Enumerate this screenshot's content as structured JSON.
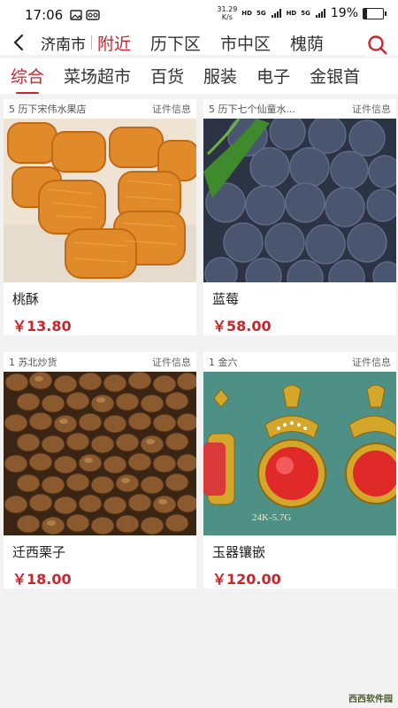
{
  "status": {
    "time": "17:06",
    "speed_value": "31.29",
    "speed_unit": "K/s",
    "hd1": "HD",
    "net1": "5G",
    "hd2": "HD",
    "net2": "5G",
    "battery": "19%",
    "battery_level": 0.19
  },
  "nav": {
    "city": "济南市",
    "tabs": [
      "附近",
      "历下区",
      "市中区",
      "槐荫"
    ]
  },
  "categories": [
    "综合",
    "菜场超市",
    "百货",
    "服装",
    "电子",
    "金银首"
  ],
  "products": [
    {
      "shop": "5 历下宋伟水果店",
      "cert": "证件信息",
      "name": "桃酥",
      "price": "￥13.80"
    },
    {
      "shop": "5 历下七个仙童水...",
      "cert": "证件信息",
      "name": "蓝莓",
      "price": "￥58.00"
    },
    {
      "shop": "1 苏北炒货",
      "cert": "证件信息",
      "name": "迁西栗子",
      "price": "￥18.00"
    },
    {
      "shop": "1 金六",
      "cert": "证件信息",
      "name": "玉器镶嵌",
      "price": "￥120.00"
    }
  ],
  "pendant_text": "24K-5.7G",
  "watermark": "西西软件园"
}
